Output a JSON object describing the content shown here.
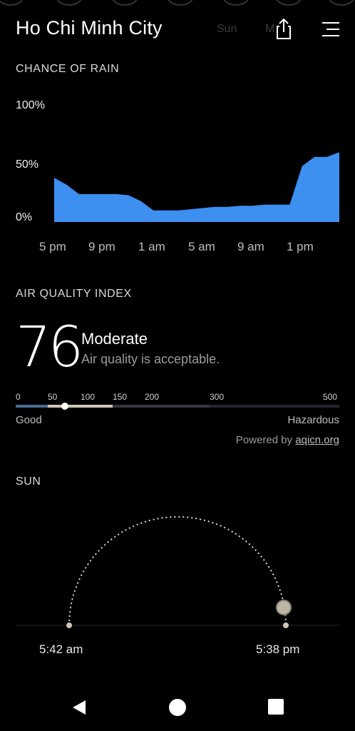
{
  "header": {
    "city": "Ho Chi Minh City",
    "ghost_tabs": [
      "Sun",
      "M"
    ]
  },
  "rain": {
    "title": "CHANCE OF RAIN",
    "y_labels": [
      "100%",
      "50%",
      "0%"
    ],
    "x_labels": [
      "5 pm",
      "9 pm",
      "1 am",
      "5 am",
      "9 am",
      "1 pm"
    ],
    "fill_color": "#3d8ff0"
  },
  "chart_data": {
    "type": "area",
    "title": "CHANCE OF RAIN",
    "xlabel": "",
    "ylabel": "",
    "ylim": [
      0,
      100
    ],
    "x_ticks": [
      "5 pm",
      "9 pm",
      "1 am",
      "5 am",
      "9 am",
      "1 pm"
    ],
    "x": [
      "5 pm",
      "6 pm",
      "7 pm",
      "8 pm",
      "9 pm",
      "10 pm",
      "11 pm",
      "12 am",
      "1 am",
      "2 am",
      "3 am",
      "4 am",
      "5 am",
      "6 am",
      "7 am",
      "8 am",
      "9 am",
      "10 am",
      "11 am",
      "12 pm",
      "1 pm",
      "2 pm",
      "3 pm",
      "4 pm"
    ],
    "series": [
      {
        "values": [
          38,
          32,
          24,
          24,
          24,
          24,
          23,
          18,
          10,
          10,
          10,
          11,
          12,
          13,
          13,
          14,
          14,
          15,
          15,
          15,
          48,
          56,
          56,
          60
        ]
      }
    ]
  },
  "aqi": {
    "title": "AIR QUALITY INDEX",
    "value": "76",
    "level": "Moderate",
    "description": "Air quality is acceptable.",
    "scale_labels": [
      "0",
      "50",
      "100",
      "150",
      "200",
      "300",
      "500"
    ],
    "min_label": "Good",
    "max_label": "Hazardous",
    "powered_prefix": "Powered by",
    "powered_link": "aqicn.org",
    "indicator_fraction": 0.152
  },
  "sun": {
    "title": "SUN",
    "sunrise": "5:42 am",
    "sunset": "5:38 pm"
  },
  "icons": {
    "share": "share-icon",
    "menu": "menu-icon",
    "back": "back-triangle-icon",
    "home": "home-circle-icon",
    "recents": "recents-square-icon"
  }
}
